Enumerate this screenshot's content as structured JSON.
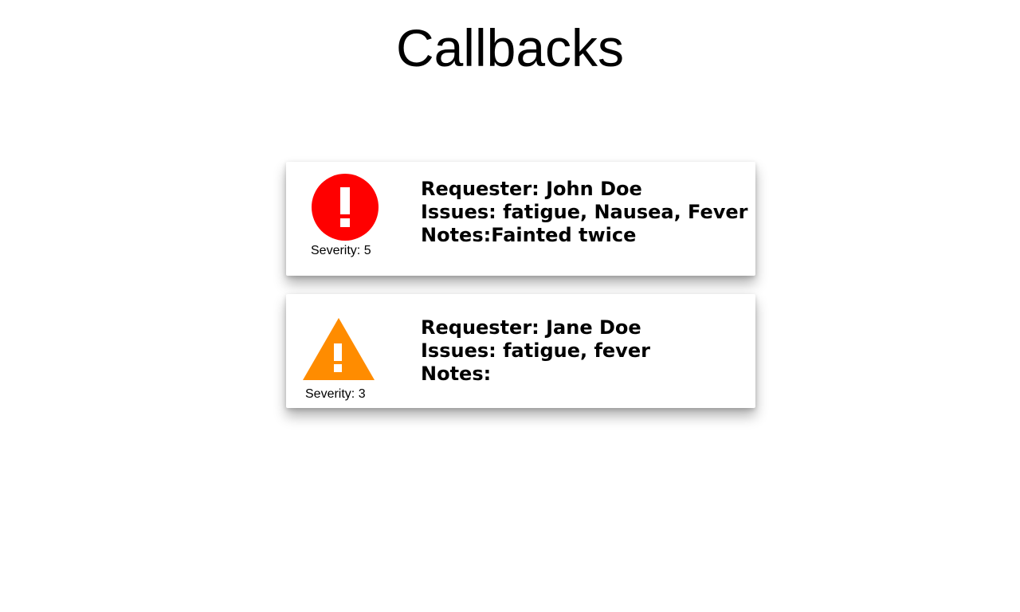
{
  "page": {
    "title": "Callbacks"
  },
  "callbacks": [
    {
      "severity_icon": "error-circle-icon",
      "severity_color": "#ff0000",
      "severity_label": "Severity: 5",
      "requester": "Requester: John Doe",
      "issues": "Issues: fatigue, Nausea, Fever",
      "notes": "Notes:Fainted twice"
    },
    {
      "severity_icon": "warning-triangle-icon",
      "severity_color": "#ff8c00",
      "severity_label": "Severity: 3",
      "requester": "Requester: Jane Doe",
      "issues": "Issues: fatigue, fever",
      "notes": "Notes:"
    }
  ]
}
